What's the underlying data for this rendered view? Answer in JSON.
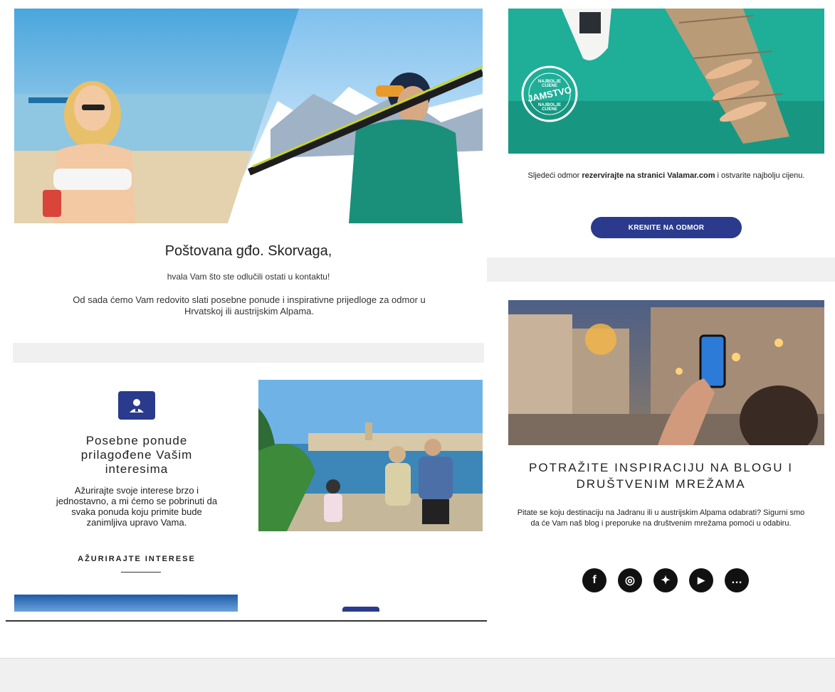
{
  "hero": {
    "greeting": "Poštovana gđo. Skorvaga,",
    "thanks": "hvala Vam što ste odlučili ostati u kontaktu!",
    "body": "Od sada ćemo Vam redovito slati posebne ponude i inspirativne prijedloge za odmor u Hrvatskoj ili austrijskim Alpama."
  },
  "offers": {
    "title": "Posebne ponude prilagođene Vašim interesima",
    "body": "Ažurirajte svoje interese brzo i jednostavno, a mi ćemo se pobrinuti da svaka ponuda koju primite bude zanimljiva upravo Vama.",
    "link_label": "AŽURIRAJTE INTERESE"
  },
  "guarantee": {
    "badge_top": "NAJBOLJE CIJENE",
    "badge_main": "JAMSTVO",
    "badge_bottom": "NAJBOLJE CIJENE",
    "text_prefix": "Sljedeći odmor ",
    "text_bold": "rezervirajte na stranici Valamar.com",
    "text_suffix": " i ostvarite najbolju cijenu.",
    "button_label": "KRENITE NA ODMOR"
  },
  "blog": {
    "title": "POTRAŽITE INSPIRACIJU NA BLOGU I DRUŠTVENIM MREŽAMA",
    "body": "Pitate se koju destinaciju na Jadranu ili u austrijskim Alpama odabrati? Sigurni smo da će Vam naš blog i preporuke na društvenim mrežama pomoći u odabiru.",
    "social": [
      {
        "name": "facebook-icon",
        "glyph": "f"
      },
      {
        "name": "instagram-icon",
        "glyph": "◎"
      },
      {
        "name": "twitter-icon",
        "glyph": "✦"
      },
      {
        "name": "youtube-icon",
        "glyph": "▶"
      },
      {
        "name": "chat-icon",
        "glyph": "…"
      }
    ]
  },
  "colors": {
    "brand": "#2a3a8c",
    "teal": "#1fae98",
    "background": "#f0f0f1"
  }
}
